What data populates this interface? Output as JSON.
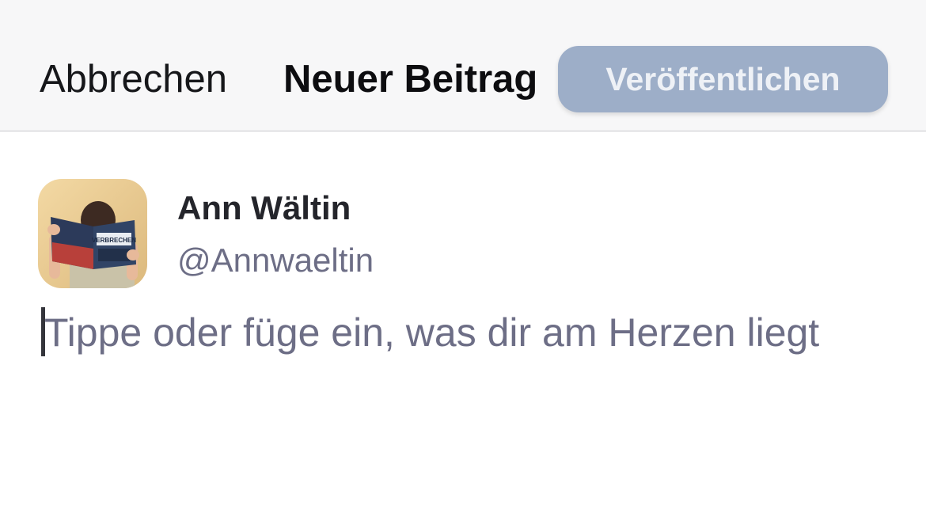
{
  "header": {
    "cancel_label": "Abbrechen",
    "title": "Neuer Beitrag",
    "publish_label": "Veröffentlichen"
  },
  "user": {
    "name": "Ann Wältin",
    "handle": "@Annwaeltin",
    "avatar_book_title": "VERBRECHEN"
  },
  "compose": {
    "placeholder": "Tippe oder füge ein, was dir am Herzen liegt",
    "value": ""
  },
  "colors": {
    "publish_button_disabled": "#9daec8",
    "header_background": "#f7f7f8",
    "secondary_text": "#6d6e86"
  }
}
